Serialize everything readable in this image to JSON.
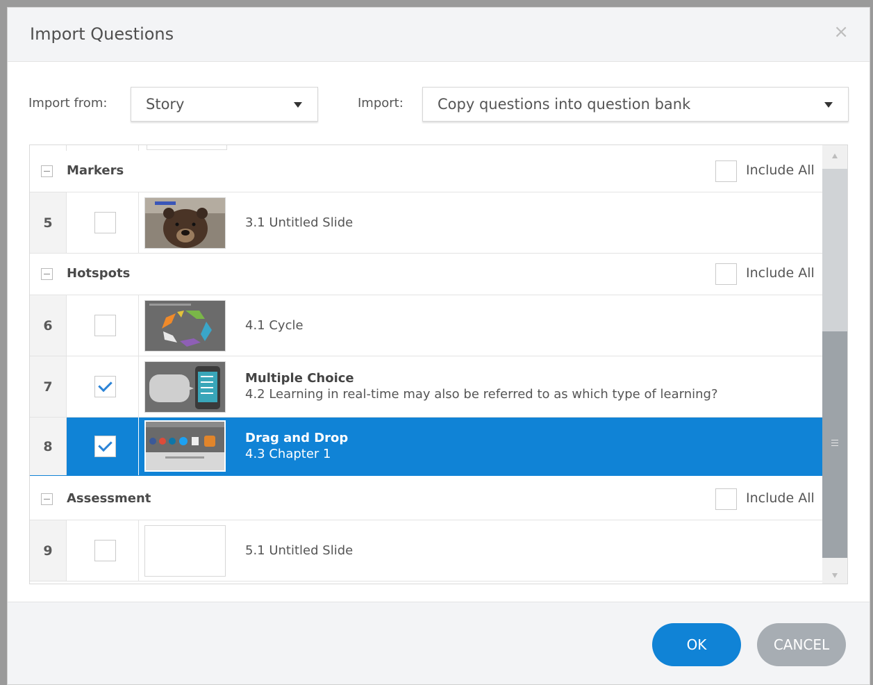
{
  "dialog": {
    "title": "Import Questions",
    "close_glyph": "×"
  },
  "controls": {
    "import_from_label": "Import from:",
    "import_from_value": "Story",
    "import_label": "Import:",
    "import_value": "Copy questions into question bank"
  },
  "groups": [
    {
      "name": "Markers",
      "include_all": "Include All"
    },
    {
      "name": "Hotspots",
      "include_all": "Include All"
    },
    {
      "name": "Assessment",
      "include_all": "Include All"
    }
  ],
  "rows": [
    {
      "num": "5",
      "checked": false,
      "selected": false,
      "type": "",
      "title": "3.1 Untitled Slide",
      "thumb": "bear-image"
    },
    {
      "num": "6",
      "checked": false,
      "selected": false,
      "type": "",
      "title": "4.1 Cycle",
      "thumb": "cycle-diagram"
    },
    {
      "num": "7",
      "checked": true,
      "selected": false,
      "type": "Multiple Choice",
      "title": "4.2 Learning in real-time may also be referred to as which type of learning?",
      "thumb": "chat-phone"
    },
    {
      "num": "8",
      "checked": true,
      "selected": true,
      "type": "Drag and Drop",
      "title": "4.3 Chapter 1",
      "thumb": "social-icons"
    },
    {
      "num": "9",
      "checked": false,
      "selected": false,
      "type": "",
      "title": "5.1 Untitled Slide",
      "thumb": "blank"
    }
  ],
  "footer": {
    "ok_label": "OK",
    "cancel_label": "CANCEL"
  },
  "colors": {
    "accent": "#1083d6",
    "cancel": "#a7adb3",
    "header_bg": "#f3f4f6"
  }
}
